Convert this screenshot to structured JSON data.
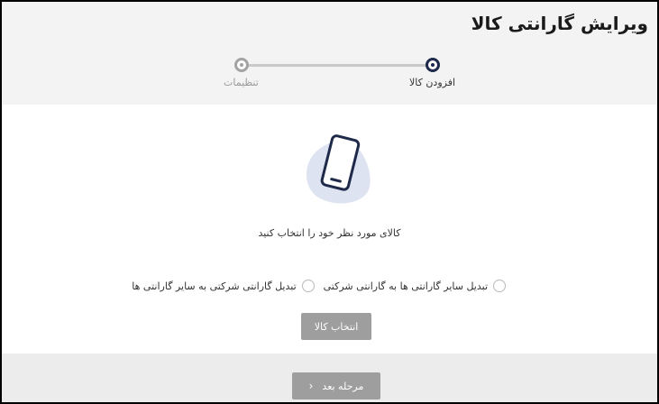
{
  "header": {
    "title": "ویرایش گارانتی کالا"
  },
  "stepper": {
    "steps": [
      {
        "label": "افزودن کالا",
        "state": "active"
      },
      {
        "label": "تنظیمات",
        "state": "inactive"
      }
    ]
  },
  "main": {
    "prompt": "کالای مورد نظر خود را انتخاب کنید",
    "radio_options": [
      {
        "label": "تبدیل گارانتی شرکتی به سایر گارانتی ها",
        "selected": false
      },
      {
        "label": "تبدیل سایر گارانتی ها به گارانتی شرکتی",
        "selected": false
      }
    ],
    "select_button": "انتخاب کالا"
  },
  "footer": {
    "next_button": "مرحله بعد",
    "next_icon": "chevron-right-icon"
  },
  "colors": {
    "accent": "#1f2a4a",
    "button_gray": "#9e9e9e",
    "illustration_bg": "#dde3f0"
  }
}
